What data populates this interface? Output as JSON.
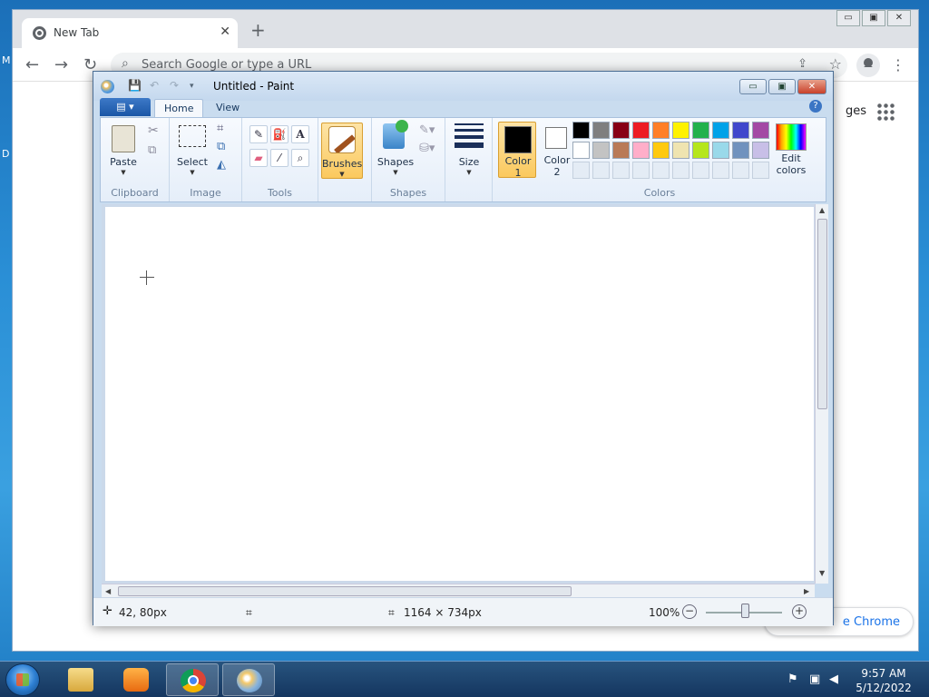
{
  "desktop": {
    "left_letters": [
      "M",
      "D"
    ]
  },
  "chrome": {
    "tab_title": "New Tab",
    "tab_close": "✕",
    "new_tab": "+",
    "window_controls": [
      "▭",
      "▣",
      "✕"
    ],
    "nav": {
      "back": "←",
      "forward": "→",
      "reload": "↻"
    },
    "omnibox_placeholder": "Search Google or type a URL",
    "images_link": "ges",
    "customize_label": "e Chrome"
  },
  "paint": {
    "title": "Untitled - Paint",
    "window_controls": {
      "minimize": "▭",
      "maximize": "▣",
      "close": "✕"
    },
    "tabs": [
      {
        "label": "Home"
      },
      {
        "label": "View"
      }
    ],
    "file_menu": "▤ ▾",
    "help": "?",
    "ribbon": {
      "groups": {
        "clipboard": "Clipboard",
        "image": "Image",
        "tools": "Tools",
        "shapes": "Shapes",
        "colors": "Colors"
      },
      "paste": "Paste",
      "select": "Select",
      "brushes": "Brushes",
      "shapes_btn": "Shapes",
      "size": "Size",
      "color1_line1": "Color",
      "color1_line2": "1",
      "color2_line1": "Color",
      "color2_line2": "2",
      "edit_colors_line1": "Edit",
      "edit_colors_line2": "colors",
      "color1_value": "#000000",
      "color2_value": "#ffffff",
      "palette_row1": [
        "#000000",
        "#7f7f7f",
        "#880015",
        "#ed1c24",
        "#ff7f27",
        "#fff200",
        "#22b14c",
        "#00a2e8",
        "#3f48cc",
        "#a349a4"
      ],
      "palette_row2": [
        "#ffffff",
        "#c3c3c3",
        "#b97a57",
        "#ffaec9",
        "#ffc90e",
        "#efe4b0",
        "#b5e61d",
        "#99d9ea",
        "#7092be",
        "#c8bfe7"
      ]
    },
    "status": {
      "cursor_pos": "42, 80px",
      "canvas_size": "1164 × 734px",
      "zoom": "100%",
      "zoom_minus": "−",
      "zoom_plus": "+"
    }
  },
  "taskbar": {
    "time": "9:57 AM",
    "date": "5/12/2022"
  }
}
